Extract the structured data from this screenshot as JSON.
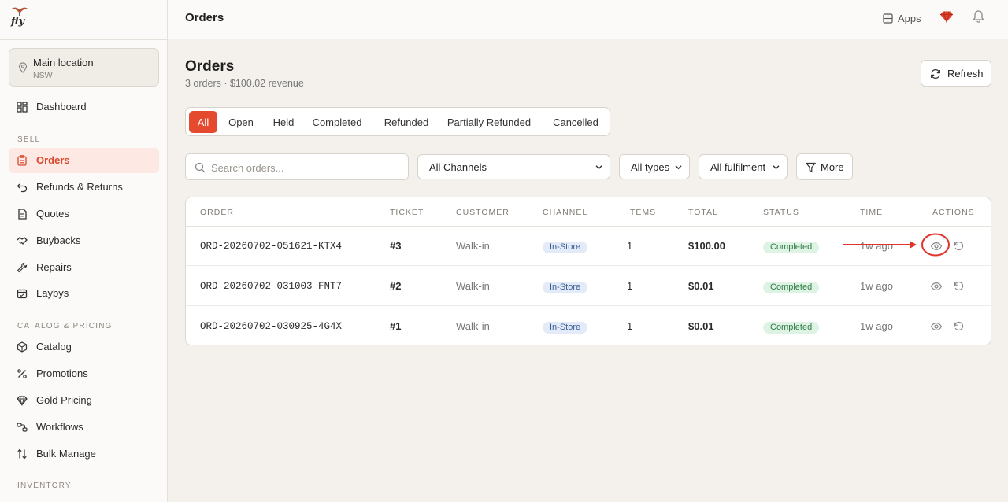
{
  "brand": {
    "logo_text": "fly"
  },
  "location": {
    "name": "Main location",
    "region": "NSW"
  },
  "sidebar": {
    "items": [
      {
        "label": "Dashboard",
        "icon": "grid-icon"
      },
      {
        "section": "SELL"
      },
      {
        "label": "Orders",
        "icon": "clipboard-icon",
        "active": true
      },
      {
        "label": "Refunds & Returns",
        "icon": "undo-icon"
      },
      {
        "label": "Quotes",
        "icon": "document-icon"
      },
      {
        "label": "Buybacks",
        "icon": "handshake-icon"
      },
      {
        "label": "Repairs",
        "icon": "wrench-icon"
      },
      {
        "label": "Laybys",
        "icon": "calendar-icon"
      },
      {
        "section": "CATALOG & PRICING"
      },
      {
        "label": "Catalog",
        "icon": "box-icon"
      },
      {
        "label": "Promotions",
        "icon": "percent-icon"
      },
      {
        "label": "Gold Pricing",
        "icon": "diamond-icon"
      },
      {
        "label": "Workflows",
        "icon": "workflow-icon"
      },
      {
        "label": "Bulk Manage",
        "icon": "sort-arrows-icon"
      },
      {
        "section": "INVENTORY"
      }
    ],
    "sections": {
      "sell": "SELL",
      "catalog": "CATALOG & PRICING",
      "inventory": "INVENTORY"
    },
    "nav": {
      "dashboard": "Dashboard",
      "orders": "Orders",
      "refunds": "Refunds & Returns",
      "quotes": "Quotes",
      "buybacks": "Buybacks",
      "repairs": "Repairs",
      "laybys": "Laybys",
      "catalog": "Catalog",
      "promotions": "Promotions",
      "gold_pricing": "Gold Pricing",
      "workflows": "Workflows",
      "bulk_manage": "Bulk Manage"
    }
  },
  "topbar": {
    "title": "Orders",
    "apps_label": "Apps"
  },
  "page": {
    "title": "Orders",
    "subtitle": "3 orders · $100.02 revenue",
    "refresh_label": "Refresh"
  },
  "tabs": {
    "all": "All",
    "open": "Open",
    "held": "Held",
    "completed": "Completed",
    "refunded": "Refunded",
    "partially_refunded": "Partially Refunded",
    "cancelled": "Cancelled",
    "active": "All"
  },
  "filters": {
    "search_placeholder": "Search orders...",
    "channel": "All Channels",
    "type": "All types",
    "fulfilment": "All fulfilment",
    "more_label": "More"
  },
  "table": {
    "headers": {
      "order": "ORDER",
      "ticket": "TICKET",
      "customer": "CUSTOMER",
      "channel": "CHANNEL",
      "items": "ITEMS",
      "total": "TOTAL",
      "status": "STATUS",
      "time": "TIME",
      "actions": "ACTIONS"
    },
    "rows": [
      {
        "order": "ORD-20260702-051621-KTX4",
        "ticket": "#3",
        "customer": "Walk-in",
        "channel": "In-Store",
        "items": "1",
        "total": "$100.00",
        "status": "Completed",
        "time": "1w ago"
      },
      {
        "order": "ORD-20260702-031003-FNT7",
        "ticket": "#2",
        "customer": "Walk-in",
        "channel": "In-Store",
        "items": "1",
        "total": "$0.01",
        "status": "Completed",
        "time": "1w ago"
      },
      {
        "order": "ORD-20260702-030925-4G4X",
        "ticket": "#1",
        "customer": "Walk-in",
        "channel": "In-Store",
        "items": "1",
        "total": "$0.01",
        "status": "Completed",
        "time": "1w ago"
      }
    ]
  },
  "colors": {
    "accent": "#e54a2e",
    "annotation": "#e0332a",
    "background": "#f4f1ec"
  }
}
